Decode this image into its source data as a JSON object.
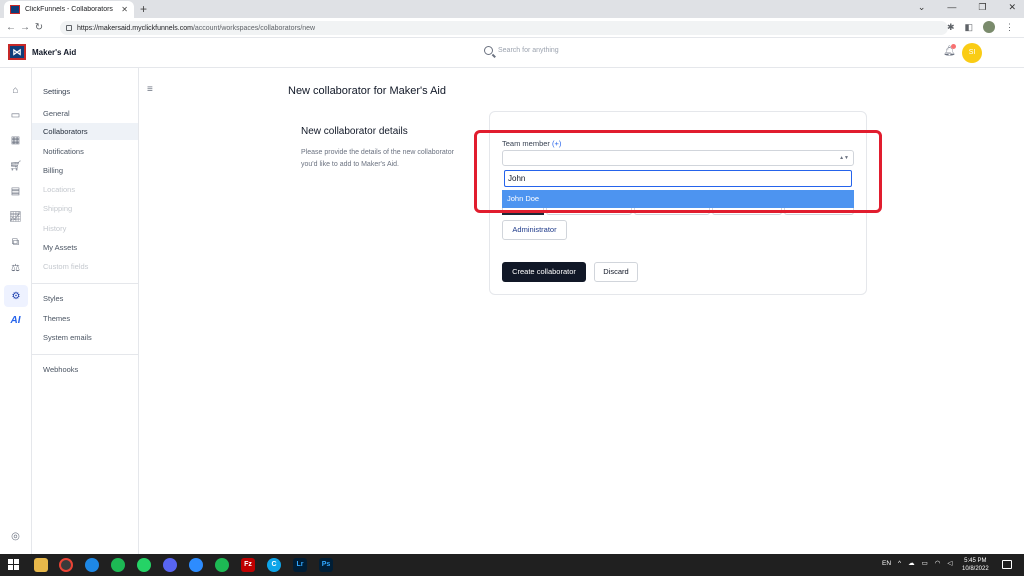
{
  "browser": {
    "tab_title": "ClickFunnels - Collaborators",
    "url_host": "https://makersaid.myclickfunnels.com",
    "url_path": "/account/workspaces/collaborators/new"
  },
  "header": {
    "workspace_name": "Maker's Aid",
    "search_placeholder": "Search for anything",
    "avatar_initials": "SI",
    "logo_icon": "clickfunnels-logo-icon"
  },
  "rail": {
    "icons": [
      "home-icon",
      "inbox-icon",
      "calendar-icon",
      "cart-icon",
      "contacts-icon",
      "analytics-icon",
      "payments-icon",
      "sales-icon",
      "settings-icon",
      "ai-icon",
      "help-icon"
    ],
    "ai_label": "AI"
  },
  "sidebar": {
    "heading": "Settings",
    "items": [
      {
        "label": "General",
        "state": "normal"
      },
      {
        "label": "Collaborators",
        "state": "active"
      },
      {
        "label": "Notifications",
        "state": "normal"
      },
      {
        "label": "Billing",
        "state": "normal"
      },
      {
        "label": "Locations",
        "state": "disabled"
      },
      {
        "label": "Shipping",
        "state": "disabled"
      },
      {
        "label": "History",
        "state": "disabled"
      },
      {
        "label": "My Assets",
        "state": "normal"
      },
      {
        "label": "Custom fields",
        "state": "disabled"
      }
    ],
    "group2": [
      "Styles",
      "Themes",
      "System emails"
    ],
    "group3": [
      "Webhooks"
    ]
  },
  "main": {
    "page_title": "New collaborator for Maker's Aid",
    "details_title": "New collaborator details",
    "details_description": "Please provide the details of the new collaborator you'd like to add to Maker's Aid.",
    "form": {
      "team_member_label": "Team member",
      "team_member_plus": "(+)",
      "dropdown_search_value": "John",
      "dropdown_option": "John Doe",
      "admin_button": "Administrator",
      "create_button": "Create collaborator",
      "discard_button": "Discard"
    }
  },
  "taskbar": {
    "language": "EN",
    "time": "5:45 PM",
    "date": "10/8/2022",
    "apps": [
      "file-explorer-icon",
      "chrome-icon",
      "edge-icon",
      "spotify-icon",
      "whatsapp-icon",
      "discord-icon",
      "zoom-icon",
      "spotify-alt-icon",
      "filezilla-icon",
      "c-app-icon",
      "lightroom-icon",
      "photoshop-icon"
    ],
    "app_labels": {
      "lightroom": "Lr",
      "photoshop": "Ps",
      "filezilla": "Fz",
      "c_app": "C"
    }
  },
  "colors": {
    "accent": "#2563eb",
    "highlight": "#e11d2e",
    "option_bg": "#4d94f0",
    "primary_button": "#111827",
    "avatar": "#facc15"
  }
}
